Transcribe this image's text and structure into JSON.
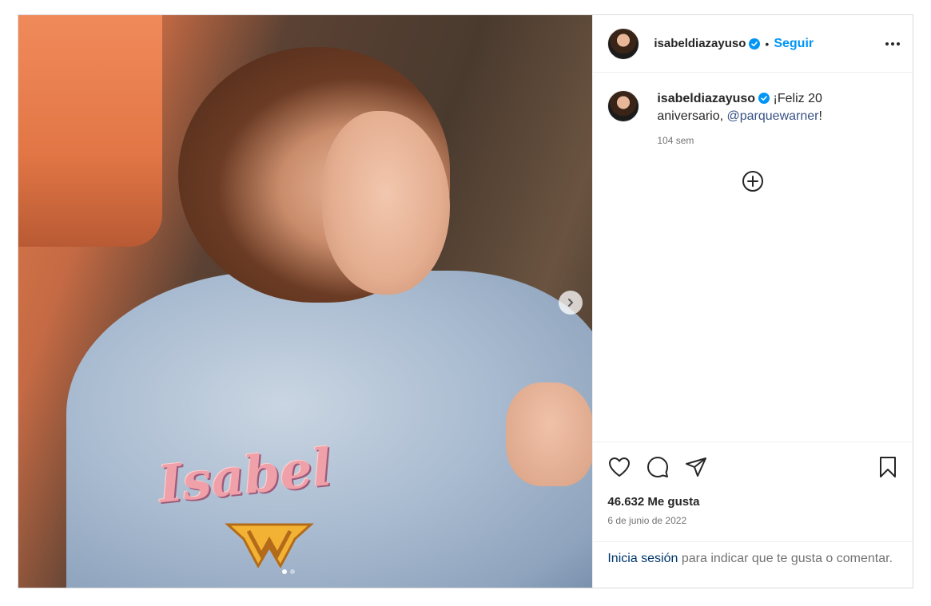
{
  "post": {
    "username": "isabeldiazayuso",
    "follow_label": "Seguir",
    "separator": "•",
    "caption_text": "¡Feliz 20 aniversario, ",
    "caption_mention": "@parquewarner",
    "caption_end": "!",
    "time_ago": "104 sem",
    "likes": "46.632 Me gusta",
    "date": "6 de junio de 2022",
    "login_link": "Inicia sesión",
    "login_text": " para indicar que te gusta o comentar.",
    "image_text": "Isabel",
    "carousel": {
      "count": 2,
      "active_index": 1
    }
  },
  "colors": {
    "accent": "#0095f6",
    "verified": "#0095f6",
    "mention": "#385185",
    "login_link": "#00376b",
    "muted": "#737373"
  },
  "icons": [
    "verified-badge-icon",
    "more-options-icon",
    "add-comment-circle-icon",
    "heart-icon",
    "comment-icon",
    "share-icon",
    "bookmark-icon",
    "chevron-right-icon"
  ]
}
